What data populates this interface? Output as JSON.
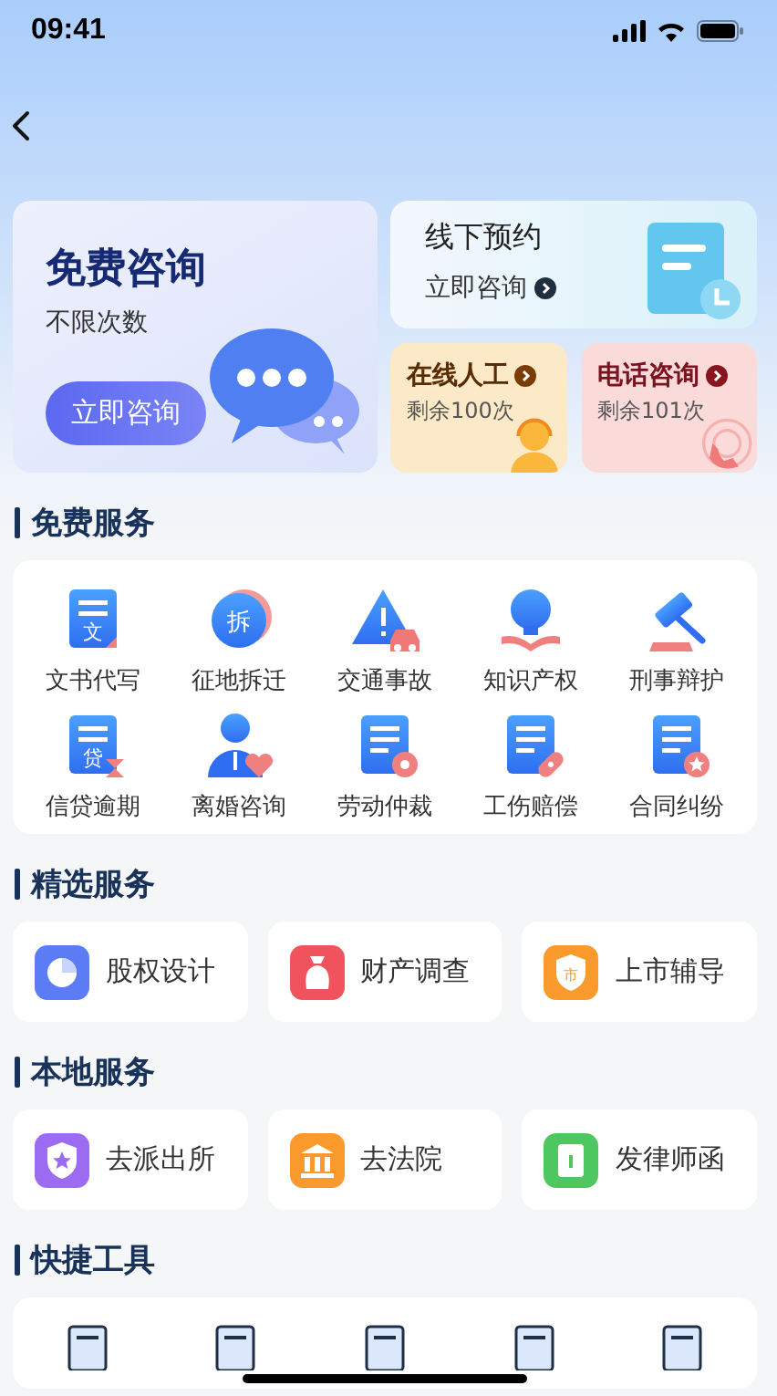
{
  "status_bar": {
    "time": "09:41"
  },
  "hero": {
    "main": {
      "title": "免费咨询",
      "subtitle": "不限次数",
      "button": "立即咨询"
    },
    "offline": {
      "title": "线下预约",
      "link": "立即咨询"
    },
    "small": [
      {
        "title": "在线人工",
        "note": "剩余100次",
        "color": "#fbe9c8"
      },
      {
        "title": "电话咨询",
        "note": "剩余101次",
        "color": "#fbdada"
      }
    ]
  },
  "free_services": {
    "title": "免费服务",
    "items": [
      {
        "label": "文书代写",
        "icon_text": "文"
      },
      {
        "label": "征地拆迁",
        "icon_text": "拆"
      },
      {
        "label": "交通事故"
      },
      {
        "label": "知识产权"
      },
      {
        "label": "刑事辩护"
      },
      {
        "label": "信贷逾期",
        "icon_text": "贷"
      },
      {
        "label": "离婚咨询"
      },
      {
        "label": "劳动仲裁"
      },
      {
        "label": "工伤赔偿"
      },
      {
        "label": "合同纠纷"
      }
    ]
  },
  "featured_services": {
    "title": "精选服务",
    "items": [
      {
        "label": "股权设计",
        "color": "#5b7cf5"
      },
      {
        "label": "财产调查",
        "color": "#f0535d"
      },
      {
        "label": "上市辅导",
        "color": "#fb9a2c",
        "icon_text": "市"
      }
    ]
  },
  "local_services": {
    "title": "本地服务",
    "items": [
      {
        "label": "去派出所",
        "color": "#9b6cf2"
      },
      {
        "label": "去法院",
        "color": "#fb9a2c"
      },
      {
        "label": "发律师函",
        "color": "#4fc760"
      }
    ]
  },
  "tools": {
    "title": "快捷工具"
  }
}
